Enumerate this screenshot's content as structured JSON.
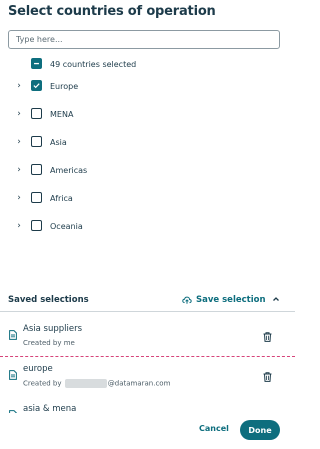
{
  "dialog": {
    "title": "Select countries of operation",
    "search_placeholder": "Type here..."
  },
  "selection": {
    "summary": "49 countries selected",
    "regions": [
      {
        "label": "Europe",
        "checked": true
      },
      {
        "label": "MENA",
        "checked": false
      },
      {
        "label": "Asia",
        "checked": false
      },
      {
        "label": "Americas",
        "checked": false
      },
      {
        "label": "Africa",
        "checked": false
      },
      {
        "label": "Oceania",
        "checked": false
      }
    ]
  },
  "saved": {
    "title": "Saved selections",
    "save_label": "Save selection",
    "items": [
      {
        "name": "Asia suppliers",
        "sub": "Created by me"
      },
      {
        "name": "europe",
        "sub_prefix": "Created by",
        "sub_suffix": "@datamaran.com"
      },
      {
        "name": "asia & mena"
      }
    ]
  },
  "footer": {
    "cancel_label": "Cancel",
    "done_label": "Done"
  },
  "colors": {
    "accent": "#0e6e7e",
    "text": "#1d3b4a",
    "separator_highlight": "#d6447a"
  },
  "icons": [
    "chevron-right-icon",
    "checkbox-icon",
    "cloud-upload-icon",
    "chevron-up-icon",
    "document-icon",
    "trash-icon"
  ]
}
